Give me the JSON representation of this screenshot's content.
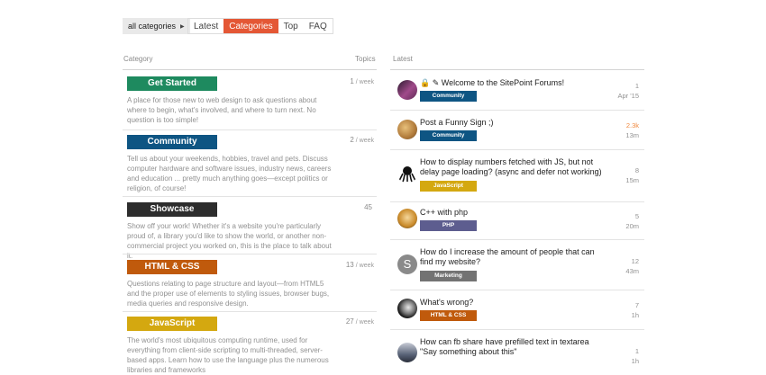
{
  "nav": {
    "category_dropdown": "all categories",
    "tabs": [
      "Latest",
      "Categories",
      "Top",
      "FAQ"
    ],
    "active_tab": "Categories"
  },
  "left": {
    "header_category": "Category",
    "header_topics": "Topics",
    "categories": [
      {
        "name": "Get Started",
        "color": "#1e8a5f",
        "count": "1",
        "per": "/ week",
        "desc": "A place for those new to web design to ask questions about where to begin, what's involved, and where to turn next. No question is too simple!"
      },
      {
        "name": "Community",
        "color": "#0e5583",
        "count": "2",
        "per": "/ week",
        "desc": "Tell us about your weekends, hobbies, travel and pets. Discuss computer hardware and software issues, industry news, careers and education ... pretty much anything goes—except politics or religion, of course!"
      },
      {
        "name": "Showcase",
        "color": "#2d2d2d",
        "count": "45",
        "per": "",
        "desc": "Show off your work! Whether it's a website you're particularly proud of, a library you'd like to show the world, or another non-commercial project you worked on, this is the place to talk about it."
      },
      {
        "name": "HTML & CSS",
        "color": "#c05a0c",
        "count": "13",
        "per": "/ week",
        "desc": "Questions relating to page structure and layout—from HTML5 and the proper use of elements to styling issues, browser bugs, media queries and responsive design."
      },
      {
        "name": "JavaScript",
        "color": "#d4a810",
        "count": "27",
        "per": "/ week",
        "desc": "The world's most ubiquitous computing runtime, used for everything from client-side scripting to multi-threaded, server-based apps. Learn how to use the language plus the numerous libraries and frameworks"
      }
    ]
  },
  "right": {
    "header_latest": "Latest",
    "topics": [
      {
        "title": "🔒 ✎ Welcome to the SitePoint Forums!",
        "tag": "Community",
        "tag_color": "#0e5583",
        "replies": "1",
        "time": "Apr '15",
        "replies_hot": false
      },
      {
        "title": "Post a Funny Sign ;)",
        "tag": "Community",
        "tag_color": "#0e5583",
        "replies": "2.3k",
        "time": "13m",
        "replies_hot": true
      },
      {
        "title": "How to display numbers fetched with JS, but not delay page loading? (async and defer not working)",
        "tag": "JavaScript",
        "tag_color": "#d4a810",
        "replies": "8",
        "time": "15m",
        "replies_hot": false
      },
      {
        "title": "C++ with php",
        "tag": "PHP",
        "tag_color": "#5d5d8f",
        "replies": "5",
        "time": "20m",
        "replies_hot": false
      },
      {
        "title": "How do I increase the amount of people that can find my website?",
        "tag": "Marketing",
        "tag_color": "#737373",
        "replies": "12",
        "time": "43m",
        "replies_hot": false,
        "avatar_letter": "S"
      },
      {
        "title": "What's wrong?",
        "tag": "HTML & CSS",
        "tag_color": "#c05a0c",
        "replies": "7",
        "time": "1h",
        "replies_hot": false
      },
      {
        "title": "How can fb share have prefilled text in textarea \"Say something about this\"",
        "tag": "",
        "tag_color": "#0e5583",
        "replies": "1",
        "time": "1h",
        "replies_hot": false
      }
    ]
  }
}
